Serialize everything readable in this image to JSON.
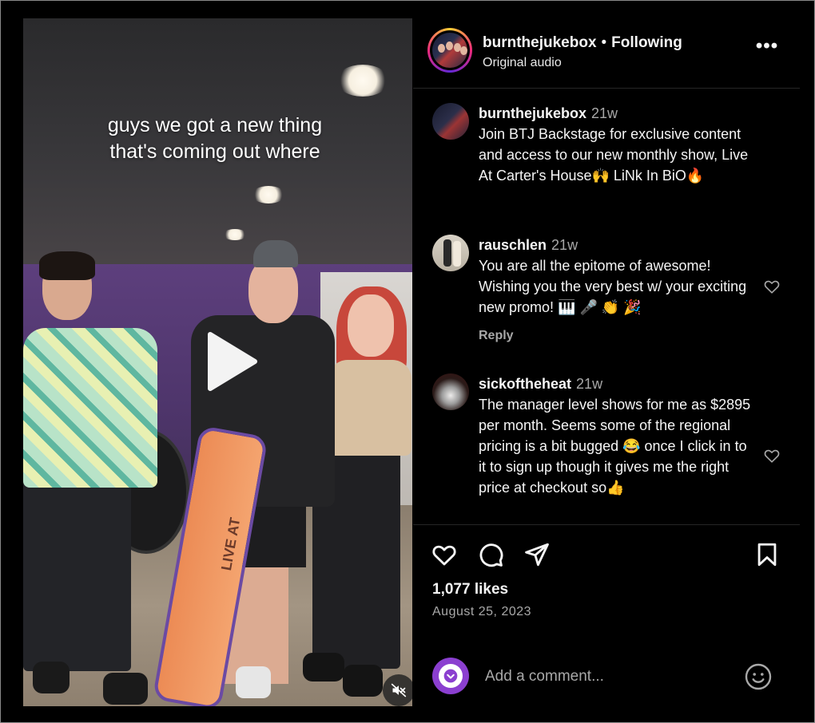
{
  "post": {
    "video_caption_line1": "guys we got a new thing",
    "video_caption_line2": "that's coming out where",
    "banner_text": "LIVE AT"
  },
  "header": {
    "username": "burnthejukebox",
    "separator": "•",
    "follow_status": "Following",
    "audio": "Original audio",
    "more": "•••"
  },
  "caption": {
    "username": "burnthejukebox",
    "time": "21w",
    "text": "Join BTJ Backstage for exclusive content and access to our new monthly show, Live At Carter's House🙌 LiNk In BiO🔥"
  },
  "comments": [
    {
      "username": "rauschlen",
      "time": "21w",
      "text": "You are all the epitome of awesome! Wishing you the very best w/ your exciting new promo! 🎹 🎤 👏 🎉",
      "reply_label": "Reply"
    },
    {
      "username": "sickoftheheat",
      "time": "21w",
      "text": "The manager level shows for me as $2895 per month. Seems some of the regional pricing is a bit bugged 😂 once I click in to it to sign up though it gives me the right price at checkout so👍"
    }
  ],
  "engagement": {
    "likes": "1,077 likes",
    "date": "August 25, 2023"
  },
  "add_comment": {
    "placeholder": "Add a comment..."
  },
  "icons": {
    "play": "play-icon",
    "mute": "muted-speaker-icon",
    "like": "heart-icon",
    "comment": "comment-bubble-icon",
    "share": "paper-plane-icon",
    "save": "bookmark-icon",
    "emoji": "smiley-icon"
  },
  "colors": {
    "background": "#000000",
    "text": "#f5f5f5",
    "muted": "#a8a8a8",
    "divider": "#262626",
    "story_ring_start": "#f9ce34",
    "story_ring_mid": "#ee2a7b",
    "story_ring_end": "#6228d7",
    "comment_avatar": "#8b3fd0"
  }
}
